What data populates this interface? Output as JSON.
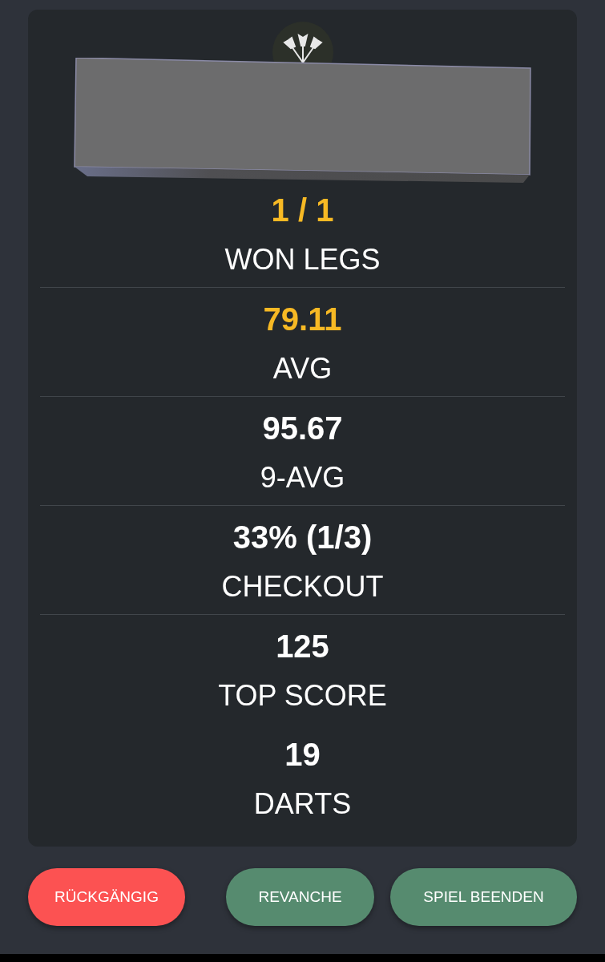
{
  "stats": [
    {
      "value": "1 / 1",
      "label": "WON LEGS",
      "highlighted": true,
      "divider": true
    },
    {
      "value": "79.11",
      "label": "AVG",
      "highlighted": true,
      "divider": true
    },
    {
      "value": "95.67",
      "label": "9-AVG",
      "highlighted": false,
      "divider": true
    },
    {
      "value": "33% (1/3)",
      "label": "CHECKOUT",
      "highlighted": false,
      "divider": true
    },
    {
      "value": "125",
      "label": "TOP SCORE",
      "highlighted": false,
      "divider": false
    },
    {
      "value": "19",
      "label": "DARTS",
      "highlighted": false,
      "divider": false
    }
  ],
  "buttons": [
    {
      "label": "RÜCKGÄNGIG",
      "color": "#fc5252"
    },
    {
      "label": "REVANCHE",
      "color": "#568b6f"
    },
    {
      "label": "SPIEL BEENDEN",
      "color": "#568b6f"
    }
  ]
}
